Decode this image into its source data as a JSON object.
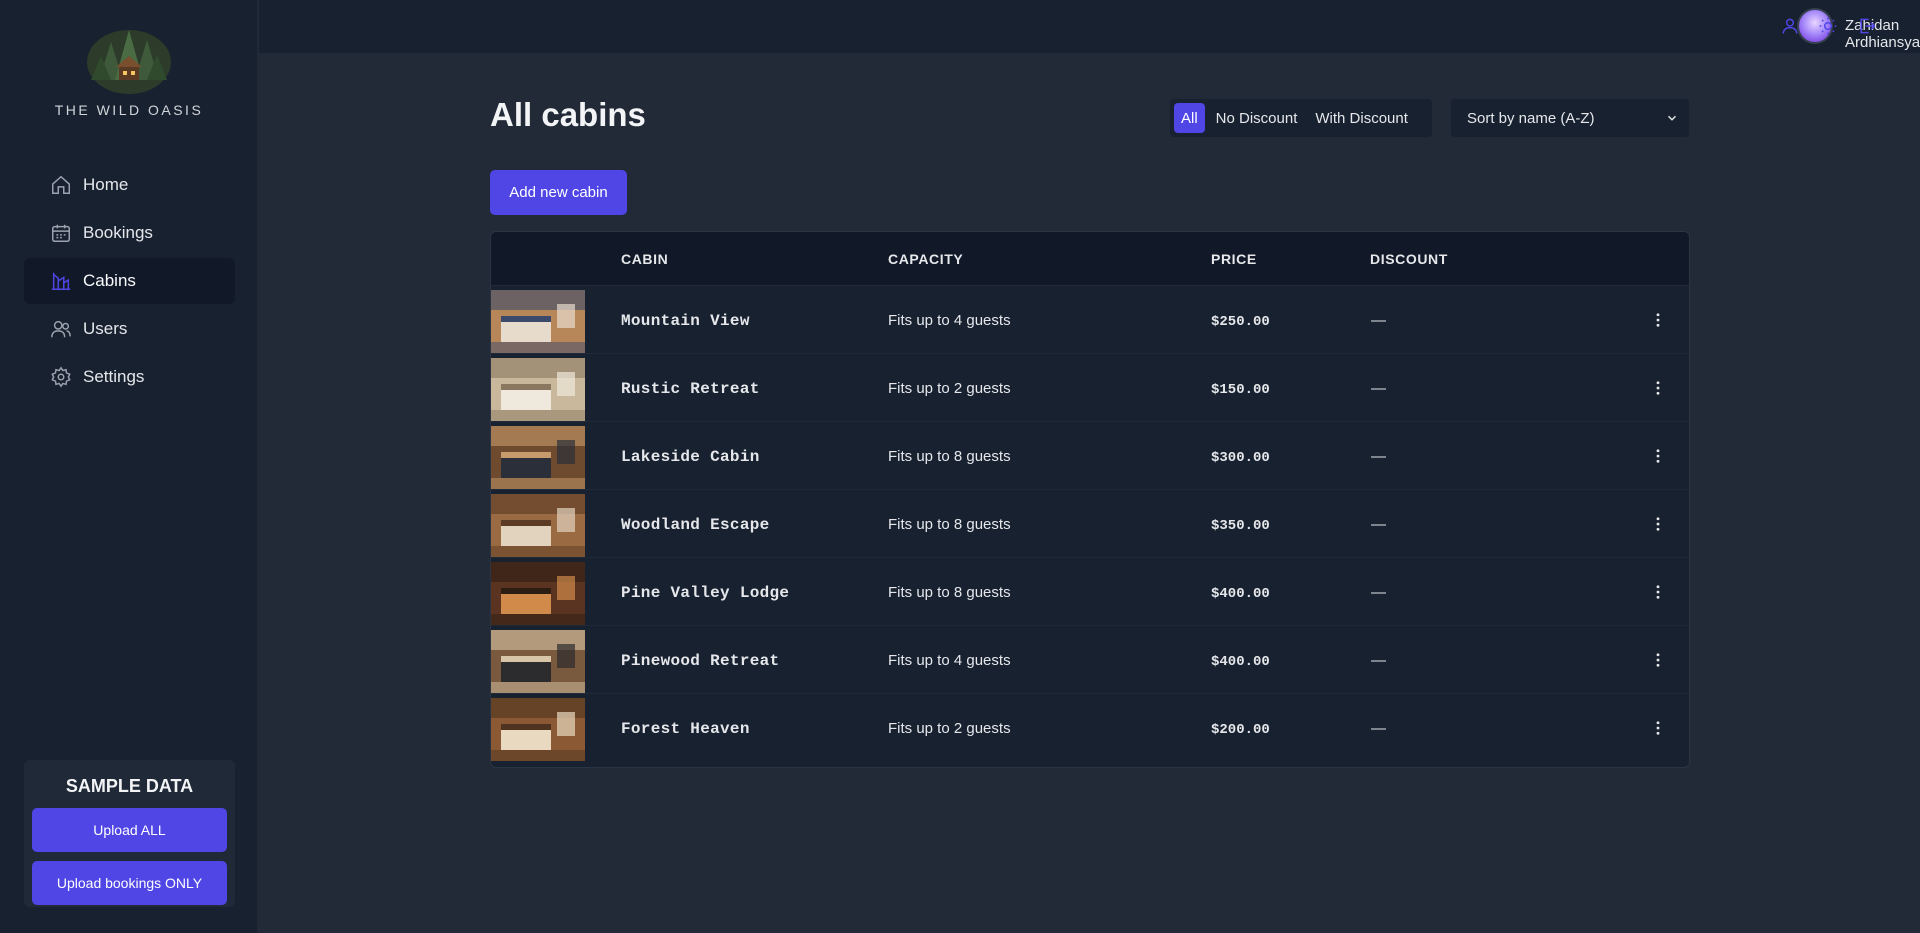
{
  "app": {
    "name": "THE WILD OASIS",
    "colors": {
      "accent": "#4f46e5",
      "sidebar_bg": "#18212f",
      "page_bg": "#222a38"
    }
  },
  "sidebar": {
    "items": [
      {
        "label": "Home",
        "icon": "home-icon",
        "active": false
      },
      {
        "label": "Bookings",
        "icon": "calendar-icon",
        "active": false
      },
      {
        "label": "Cabins",
        "icon": "cabins-icon",
        "active": true
      },
      {
        "label": "Users",
        "icon": "users-icon",
        "active": false
      },
      {
        "label": "Settings",
        "icon": "gear-icon",
        "active": false
      }
    ],
    "sample_data": {
      "title": "SAMPLE DATA",
      "upload_all": "Upload ALL",
      "upload_bookings": "Upload bookings ONLY"
    }
  },
  "header": {
    "user_name": "Zahidan Ardhiansyah",
    "icons": [
      "user-icon",
      "sun-icon",
      "logout-icon"
    ]
  },
  "main": {
    "title": "All cabins",
    "filters": [
      {
        "label": "All",
        "active": true
      },
      {
        "label": "No Discount",
        "active": false
      },
      {
        "label": "With Discount",
        "active": false
      }
    ],
    "sort": {
      "selected": "Sort by name (A-Z)"
    },
    "add_button": "Add new cabin",
    "table": {
      "columns": [
        "",
        "CABIN",
        "CAPACITY",
        "PRICE",
        "DISCOUNT",
        ""
      ],
      "rows": [
        {
          "name": "Mountain View",
          "capacity": "Fits up to 4 guests",
          "price": "$250.00",
          "discount": "—"
        },
        {
          "name": "Rustic Retreat",
          "capacity": "Fits up to 2 guests",
          "price": "$150.00",
          "discount": "—"
        },
        {
          "name": "Lakeside Cabin",
          "capacity": "Fits up to 8 guests",
          "price": "$300.00",
          "discount": "—"
        },
        {
          "name": "Woodland Escape",
          "capacity": "Fits up to 8 guests",
          "price": "$350.00",
          "discount": "—"
        },
        {
          "name": "Pine Valley Lodge",
          "capacity": "Fits up to 8 guests",
          "price": "$400.00",
          "discount": "—"
        },
        {
          "name": "Pinewood Retreat",
          "capacity": "Fits up to 4 guests",
          "price": "$400.00",
          "discount": "—"
        },
        {
          "name": "Forest Heaven",
          "capacity": "Fits up to 2 guests",
          "price": "$200.00",
          "discount": "—"
        }
      ]
    }
  }
}
